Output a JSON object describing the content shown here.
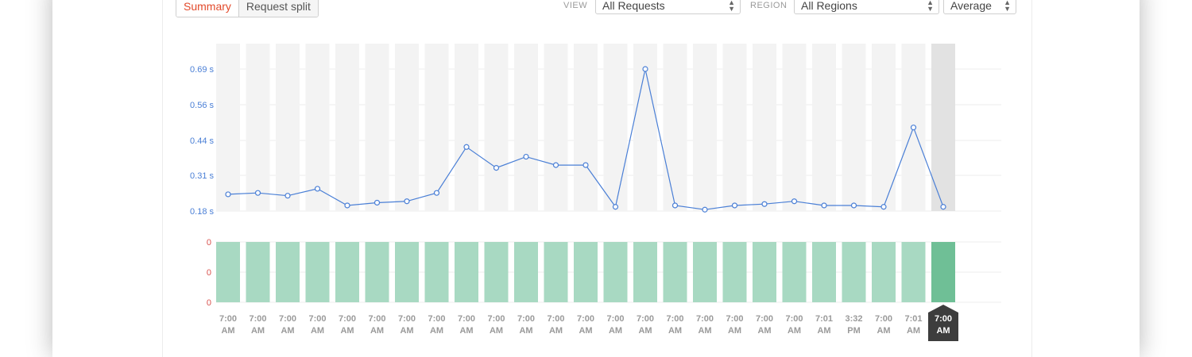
{
  "tabs": [
    {
      "label": "Summary",
      "active": true
    },
    {
      "label": "Request split",
      "active": false
    }
  ],
  "filters": {
    "view_label": "VIEW",
    "view_value": "All Requests",
    "region_label": "REGION",
    "region_value": "All Regions",
    "aggregate_value": "Average"
  },
  "colors": {
    "accent_active_tab": "#e24a2b",
    "line": "#4a7fd6",
    "bar": "#a8d9c2",
    "bar_selected": "#6fbf96",
    "column_bg": "#f3f3f3",
    "column_selected_bg": "#e2e2e2",
    "tooltip_bg": "#3d3d3d"
  },
  "chart_data": [
    {
      "type": "line",
      "y_ticks": [
        "0.69 s",
        "0.56 s",
        "0.44 s",
        "0.31 s",
        "0.18 s"
      ],
      "ylim": [
        0.18,
        0.69
      ],
      "x": [
        "7:00 AM",
        "7:00 AM",
        "7:00 AM",
        "7:00 AM",
        "7:00 AM",
        "7:00 AM",
        "7:00 AM",
        "7:00 AM",
        "7:00 AM",
        "7:00 AM",
        "7:00 AM",
        "7:00 AM",
        "7:00 AM",
        "7:00 AM",
        "7:00 AM",
        "7:00 AM",
        "7:00 AM",
        "7:00 AM",
        "7:00 AM",
        "7:00 AM",
        "7:01 AM",
        "3:32 PM",
        "7:00 AM",
        "7:01 AM",
        "7:00 AM"
      ],
      "values": [
        0.24,
        0.245,
        0.235,
        0.26,
        0.2,
        0.21,
        0.215,
        0.245,
        0.41,
        0.335,
        0.375,
        0.345,
        0.345,
        0.195,
        0.69,
        0.2,
        0.185,
        0.2,
        0.205,
        0.215,
        0.2,
        0.2,
        0.195,
        0.48,
        0.195
      ],
      "selected_index": 24
    },
    {
      "type": "bar",
      "y_ticks": [
        "0",
        "0",
        "0"
      ],
      "x": [
        "7:00 AM",
        "7:00 AM",
        "7:00 AM",
        "7:00 AM",
        "7:00 AM",
        "7:00 AM",
        "7:00 AM",
        "7:00 AM",
        "7:00 AM",
        "7:00 AM",
        "7:00 AM",
        "7:00 AM",
        "7:00 AM",
        "7:00 AM",
        "7:00 AM",
        "7:00 AM",
        "7:00 AM",
        "7:00 AM",
        "7:00 AM",
        "7:00 AM",
        "7:01 AM",
        "3:32 PM",
        "7:00 AM",
        "7:01 AM",
        "7:00 AM"
      ],
      "values": [
        1,
        1,
        1,
        1,
        1,
        1,
        1,
        1,
        1,
        1,
        1,
        1,
        1,
        1,
        1,
        1,
        1,
        1,
        1,
        1,
        1,
        1,
        1,
        1,
        1
      ],
      "selected_index": 24
    }
  ]
}
